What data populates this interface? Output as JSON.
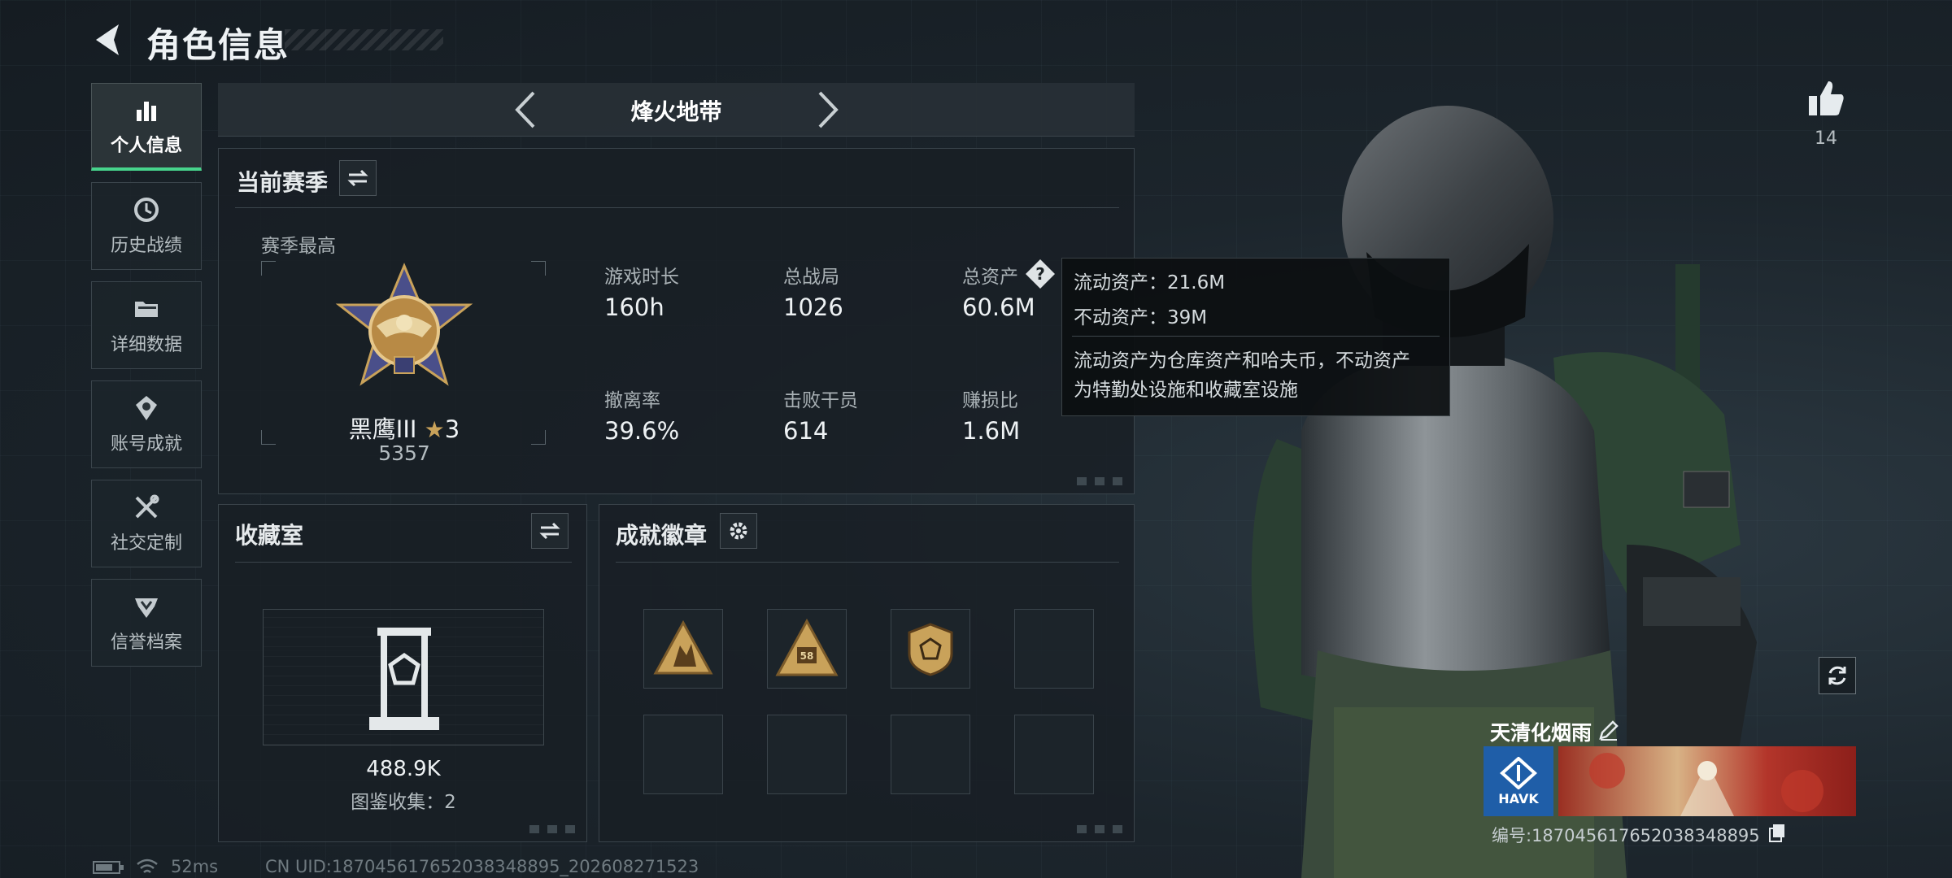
{
  "header": {
    "title": "角色信息"
  },
  "sidebar": {
    "items": [
      {
        "label": "个人信息"
      },
      {
        "label": "历史战绩"
      },
      {
        "label": "详细数据"
      },
      {
        "label": "账号成就"
      },
      {
        "label": "社交定制"
      },
      {
        "label": "信誉档案"
      }
    ]
  },
  "mode_tabs": {
    "current": "烽火地带"
  },
  "season": {
    "title": "当前赛季",
    "best_label": "赛季最高",
    "rank_name": "黑鹰III",
    "rank_stars": "3",
    "rank_score": "5357",
    "stats": [
      {
        "label": "游戏时长",
        "value": "160h"
      },
      {
        "label": "总战局",
        "value": "1026"
      },
      {
        "label": "总资产",
        "value": "60.6M"
      },
      {
        "label": "撤离率",
        "value": "39.6%"
      },
      {
        "label": "击败干员",
        "value": "614"
      },
      {
        "label": "赚损比",
        "value": "1.6M"
      }
    ]
  },
  "tooltip": {
    "liquid": "流动资产：21.6M",
    "fixed": "不动资产：39M",
    "desc_line1": "流动资产为仓库资产和哈夫币，不动资产",
    "desc_line2": "为特勤处设施和收藏室设施"
  },
  "collection": {
    "title": "收藏室",
    "value": "488.9K",
    "count_label": "图鉴收集：2"
  },
  "achievements": {
    "title": "成就徽章",
    "badges": [
      "badge-soldiers",
      "badge-58",
      "badge-shield",
      "empty",
      "empty",
      "empty",
      "empty",
      "empty"
    ]
  },
  "profile": {
    "likes": "14",
    "nickname": "天清化烟雨",
    "id_label": "编号:187045617652038348895",
    "logo_text": "HAVK"
  },
  "status": {
    "ping": "52ms",
    "uid": "CN UID:187045617652038348895_202608271523"
  },
  "colors": {
    "accent": "#47d48c",
    "gold": "#c9a25a"
  }
}
